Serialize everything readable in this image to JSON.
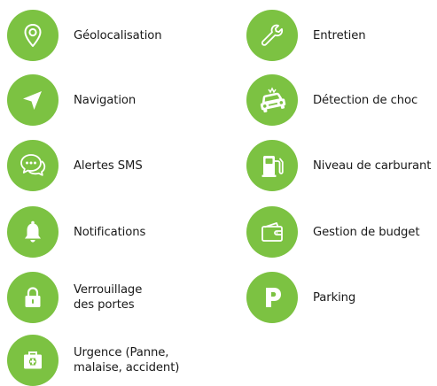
{
  "accent_color": "#7cc242",
  "features_left": [
    {
      "icon": "location-pin-icon",
      "label": "Géolocalisation"
    },
    {
      "icon": "navigation-arrow-icon",
      "label": "Navigation"
    },
    {
      "icon": "chat-bubbles-icon",
      "label": "Alertes SMS"
    },
    {
      "icon": "bell-icon",
      "label": "Notifications"
    },
    {
      "icon": "padlock-icon",
      "label_lines": [
        "Verrouillage",
        "des portes"
      ]
    },
    {
      "icon": "first-aid-kit-icon",
      "label_lines": [
        "Urgence (Panne,",
        "malaise, accident)"
      ]
    }
  ],
  "features_right": [
    {
      "icon": "wrench-icon",
      "label": "Entretien"
    },
    {
      "icon": "car-crash-icon",
      "label": "Détection de choc"
    },
    {
      "icon": "fuel-pump-icon",
      "label": "Niveau de carburant"
    },
    {
      "icon": "wallet-icon",
      "label": "Gestion de budget"
    },
    {
      "icon": "parking-icon",
      "label": "Parking"
    }
  ]
}
